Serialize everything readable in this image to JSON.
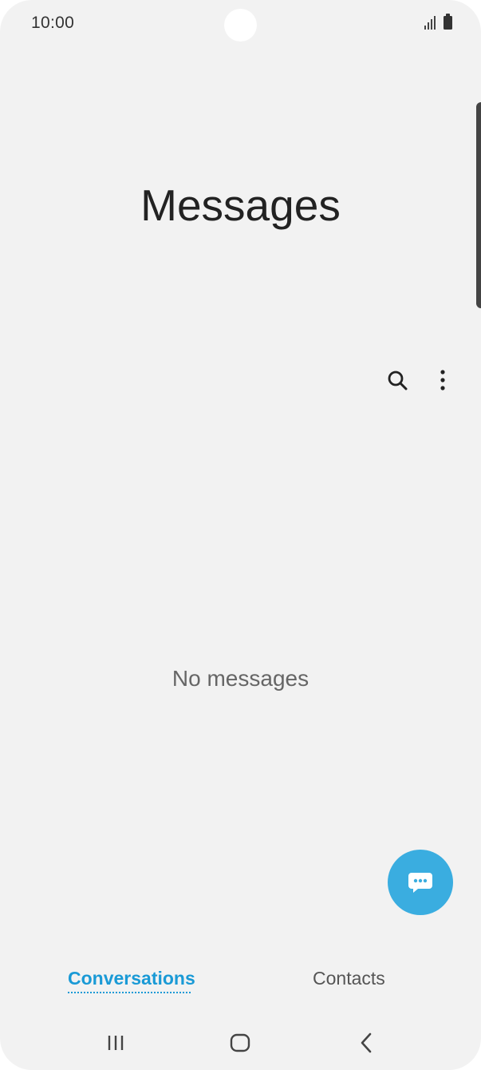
{
  "status_bar": {
    "time": "10:00"
  },
  "header": {
    "title": "Messages"
  },
  "toolbar": {
    "search_icon": "search-icon",
    "more_icon": "more-vertical-icon"
  },
  "main": {
    "empty_text": "No messages"
  },
  "fab": {
    "icon": "compose-message-icon",
    "color": "#3aade0"
  },
  "tabs": [
    {
      "label": "Conversations",
      "selected": true,
      "color": "#1a9ad6"
    },
    {
      "label": "Contacts",
      "selected": false
    }
  ],
  "nav_bar": {
    "recents_icon": "recents-icon",
    "home_icon": "home-icon",
    "back_icon": "back-icon"
  }
}
